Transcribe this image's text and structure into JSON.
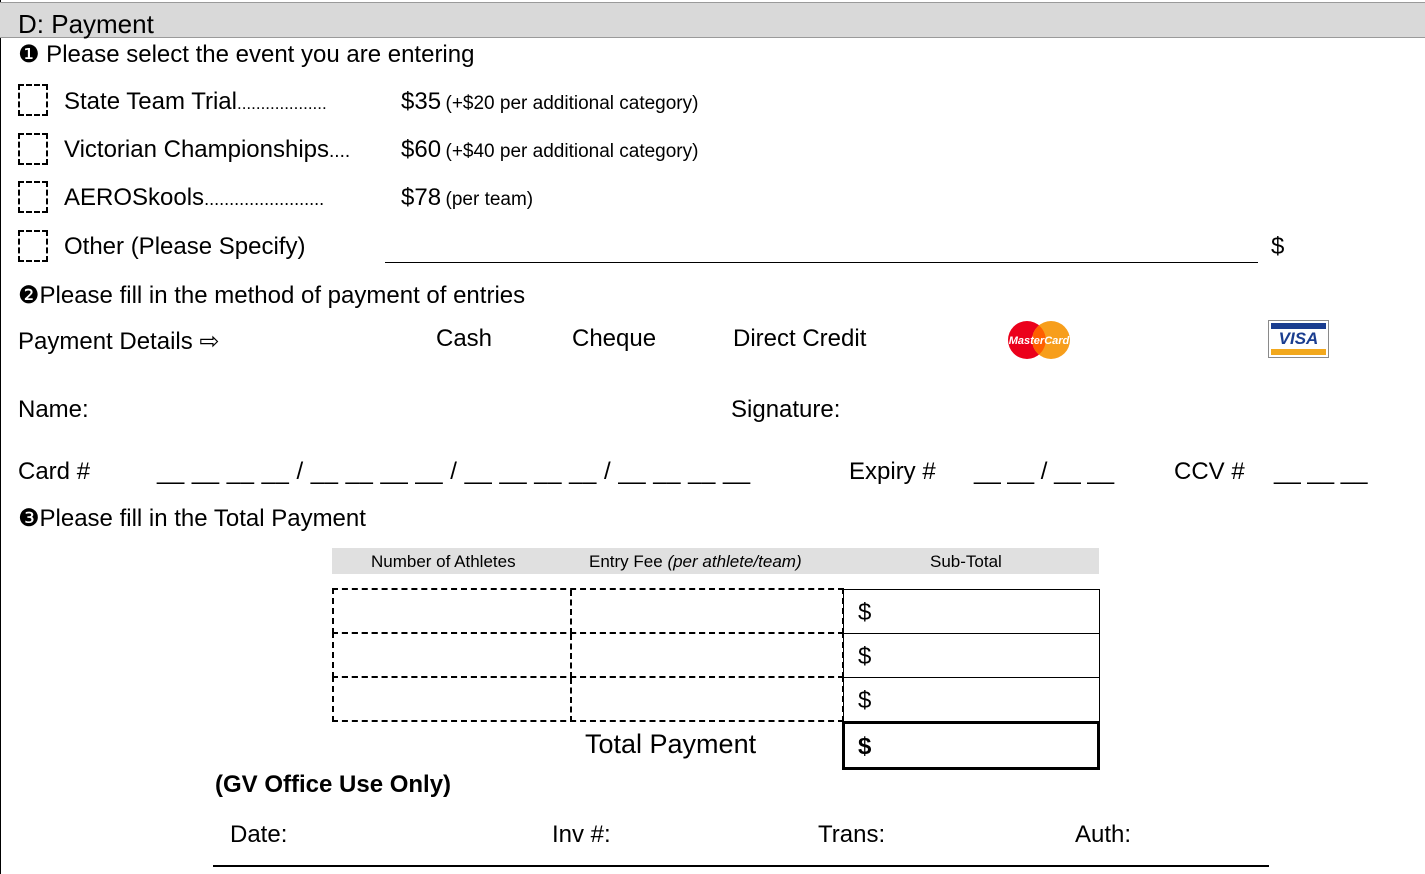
{
  "section": {
    "title": "D: Payment"
  },
  "q1": {
    "text": "❶ Please select the event you are entering"
  },
  "events": [
    {
      "label": "State Team Trial",
      "dots": "...................",
      "price": "$35",
      "note": "(+$20 per additional category)"
    },
    {
      "label": "Victorian Championships",
      "dots": "....",
      "price": "$60",
      "note": "(+$40 per additional category)"
    },
    {
      "label": "AEROSkools",
      "dots": "........................",
      "price": "$78",
      "note": "(per team)"
    },
    {
      "label": "Other (Please Specify)",
      "dots": "",
      "price": "",
      "note": "",
      "amount_symbol": "$"
    }
  ],
  "q2": {
    "text": "❷Please fill in the method of payment of entries"
  },
  "payment": {
    "label": "Payment Details ⇨",
    "options": [
      "Cash",
      "Cheque",
      "Direct Credit"
    ],
    "mastercard_text": "MasterCard",
    "visa_text": "VISA"
  },
  "fields": {
    "name_label": "Name:",
    "signature_label": "Signature:",
    "card_label": "Card #",
    "card_blanks": "__ __ __ __ / __ __ __ __ / __ __ __ __ / __ __ __ __",
    "expiry_label": "Expiry #",
    "expiry_blanks": "__ __ / __ __",
    "ccv_label": "CCV #",
    "ccv_blanks": "__ __ __"
  },
  "q3": {
    "text": "❸Please fill in the Total Payment"
  },
  "total_table": {
    "headers": {
      "athletes": "Number of Athletes",
      "fee": "Entry Fee",
      "fee_note": "(per athlete/team)",
      "subtotal": "Sub-Total"
    },
    "currency_symbol": "$",
    "total_label": "Total Payment",
    "total_symbol": "$"
  },
  "office": {
    "title": "(GV Office Use Only)",
    "date_label": "Date:",
    "inv_label": "Inv #:",
    "trans_label": "Trans:",
    "auth_label": "Auth:"
  },
  "colors": {
    "header_bg": "#d9d9d9",
    "mastercard_red": "#eb001b",
    "mastercard_orange": "#f79e1b",
    "visa_blue": "#1a3d8f",
    "visa_gold": "#f2a81d"
  }
}
